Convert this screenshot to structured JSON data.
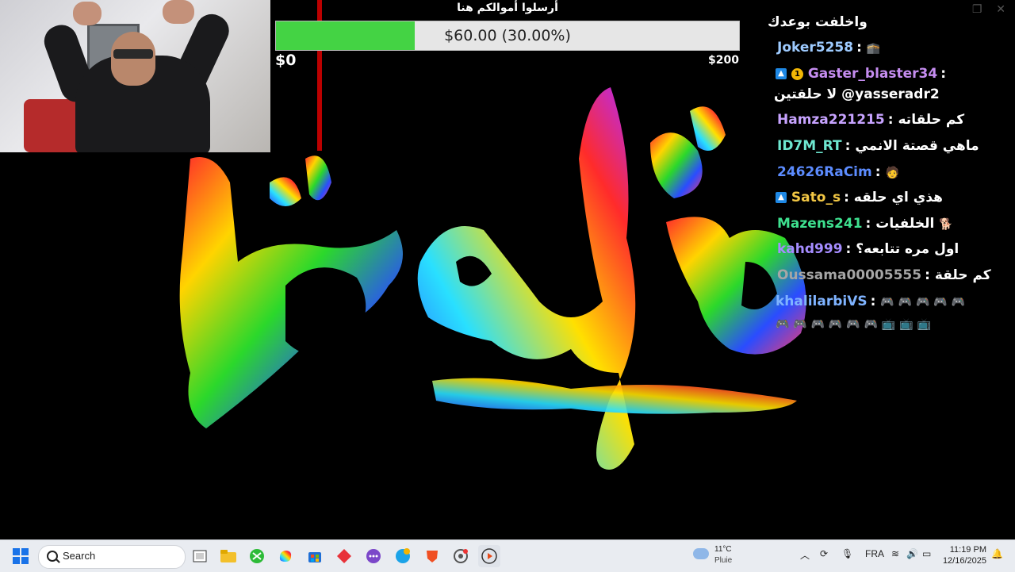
{
  "overlay": {
    "goal_title": "أرسلوا أموالكم هنا",
    "goal_text": "$60.00 (30.00%)",
    "goal_progress": 0.3,
    "goal_min": "$0",
    "goal_max": "$200",
    "goal_fill_color": "#44d344"
  },
  "chat": {
    "top_partial": "واخلفت بوعدك",
    "messages": [
      {
        "user": "Joker5258",
        "sep": ":",
        "text": "",
        "emote": "🕋",
        "color": "#9ecbff",
        "badges": []
      },
      {
        "user": "Gaster_blaster34",
        "sep": ":",
        "text": "",
        "emote": "",
        "color": "#c58df0",
        "badges": [
          "twitch-prime-badge",
          "coin-badge"
        ]
      },
      {
        "user": "",
        "sep": "",
        "text": "لا حلقتين @yasseradr2",
        "emote": "",
        "color": "#ffffff",
        "badges": []
      },
      {
        "user": "Hamza221215",
        "sep": ":",
        "text": "كم حلقاته",
        "emote": "",
        "color": "#c7a3ff",
        "badges": []
      },
      {
        "user": "ID7M_RT",
        "sep": ":",
        "text": "ماهي قصتة الانمي",
        "emote": "",
        "color": "#6ee7d0",
        "badges": []
      },
      {
        "user": "24626RaCim",
        "sep": ":",
        "text": "",
        "emote": "🧑",
        "color": "#5c8cff",
        "badges": []
      },
      {
        "user": "Sato_s",
        "sep": ":",
        "text": "هذي اي حلقه",
        "emote": "",
        "color": "#f2c744",
        "badges": [
          "twitch-prime-badge"
        ]
      },
      {
        "user": "Mazens241",
        "sep": ":",
        "text": "الخلفيات",
        "emote": "🐕 ☝",
        "color": "#3ee08f",
        "badges": []
      },
      {
        "user": "kahd999",
        "sep": ":",
        "text": "اول مره تتابعه؟",
        "emote": "",
        "color": "#a58cff",
        "badges": []
      },
      {
        "user": "Oussama00005555",
        "sep": ":",
        "text": "كم حلقة",
        "emote": "",
        "color": "#a6a6a6",
        "badges": []
      },
      {
        "user": "khalilarbiVS",
        "sep": ":",
        "text": "",
        "emote": "🎮 🎮 🎮 🎮 🎮",
        "color": "#7fb3ff",
        "badges": []
      }
    ],
    "continuation_emotes": "🎮 🎮 🎮 🎮 🎮 🎮 📺 📺 📺"
  },
  "taskbar": {
    "search_placeholder": "Search",
    "weather_temp": "11°C",
    "weather_desc": "Pluie",
    "language": "FRA",
    "time": "11:19 PM",
    "date": "12/16/2025",
    "apps": [
      "start-icon",
      "task-view-icon",
      "file-explorer-icon",
      "xbox-icon",
      "copilot-icon",
      "microsoft-store-icon",
      "app-red-icon",
      "messenger-icon",
      "edge-icon",
      "brave-icon",
      "chrome-icon",
      "media-player-icon"
    ]
  },
  "colors": {
    "accent": "#44d344",
    "taskbar_bg": "#e9ecf1"
  }
}
